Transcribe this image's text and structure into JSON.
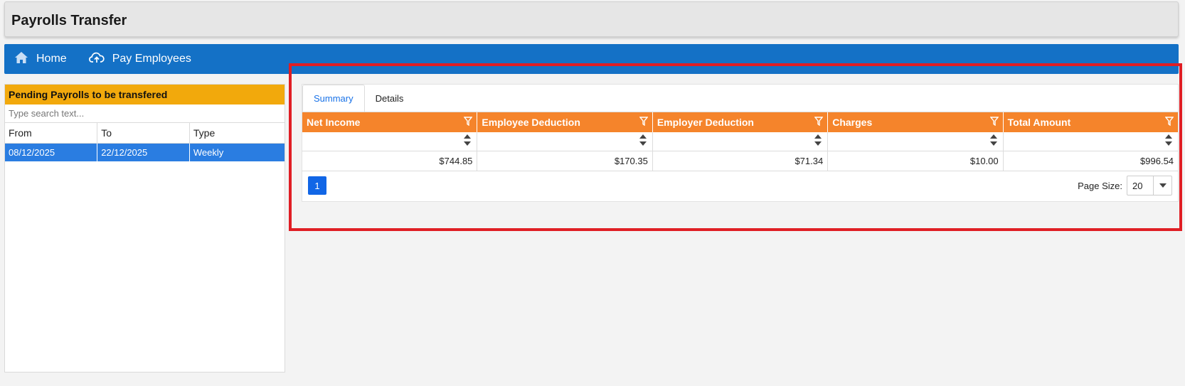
{
  "app": {
    "title": "Payrolls Transfer"
  },
  "nav": {
    "items": [
      {
        "label": "Home",
        "icon": "home-icon"
      },
      {
        "label": "Pay Employees",
        "icon": "cloud-upload-icon"
      }
    ],
    "color": "#1471c6"
  },
  "pending": {
    "header": "Pending Payrolls to be transfered",
    "search_placeholder": "Type search text...",
    "columns": [
      "From",
      "To",
      "Type"
    ],
    "rows": [
      {
        "from": "08/12/2025",
        "to": "22/12/2025",
        "type": "Weekly"
      }
    ],
    "header_color": "#f2a90c"
  },
  "details": {
    "tabs": [
      {
        "label": "Summary",
        "active": true
      },
      {
        "label": "Details",
        "active": false
      }
    ],
    "columns": [
      "Net Income",
      "Employee Deduction",
      "Employer Deduction",
      "Charges",
      "Total Amount"
    ],
    "row": [
      "$744.85",
      "$170.35",
      "$71.34",
      "$10.00",
      "$996.54"
    ],
    "header_color": "#f5842b",
    "pager": {
      "current_page": "1",
      "page_size_label": "Page Size:",
      "page_size": "20"
    }
  }
}
